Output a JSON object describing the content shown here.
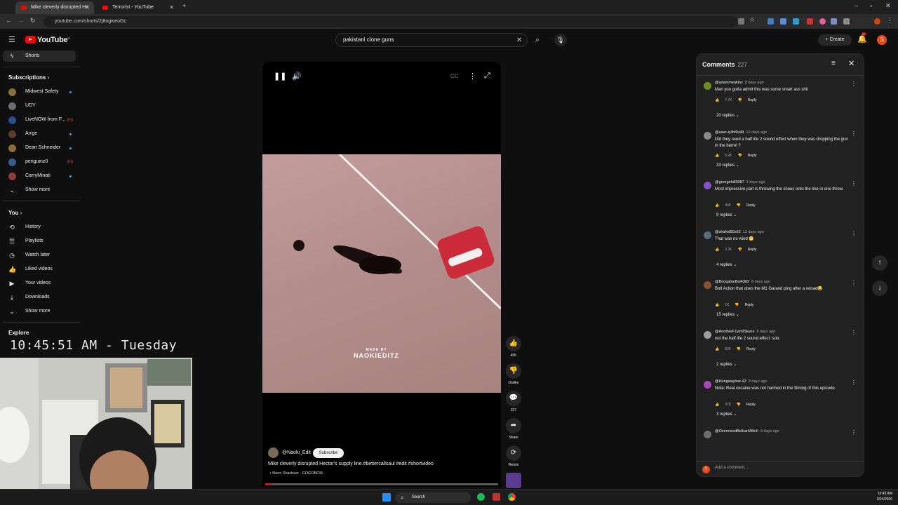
{
  "browser": {
    "tabs": [
      {
        "title": "Mike cleverly disrupted He"
      },
      {
        "title": "Terrorist - YouTube"
      }
    ],
    "url": "youtube.com/shorts/2j8ogiveoGc"
  },
  "header": {
    "logo": "YouTube",
    "logo_sup": "IN",
    "search_value": "pakistani clone guns",
    "create_label": "Create",
    "bell_badge": "9+",
    "avatar_letter": "S"
  },
  "sidebar": {
    "shorts_label": "Shorts",
    "subscriptions_label": "Subscriptions",
    "subscriptions": [
      {
        "label": "Midwest Safety",
        "color": "#8a6d3b",
        "marker": "dot"
      },
      {
        "label": "UDY",
        "color": "#6d6d6d",
        "marker": ""
      },
      {
        "label": "LiveNOW from F...",
        "color": "#2a4d8f",
        "marker": "live"
      },
      {
        "label": "Arrge",
        "color": "#5a3d2b",
        "marker": "dot"
      },
      {
        "label": "Dean Schneider",
        "color": "#8f6b3a",
        "marker": "dot"
      },
      {
        "label": "penguinz0",
        "color": "#3b5a8f",
        "marker": "live"
      },
      {
        "label": "CarryMinati",
        "color": "#8f3b3b",
        "marker": "dot"
      }
    ],
    "show_more": "Show more",
    "you_label": "You",
    "you_items": [
      {
        "label": "History",
        "icon": "history-icon",
        "glyph": "⟲"
      },
      {
        "label": "Playlists",
        "icon": "playlists-icon",
        "glyph": "☰"
      },
      {
        "label": "Watch later",
        "icon": "watch-later-icon",
        "glyph": "◷"
      },
      {
        "label": "Liked videos",
        "icon": "like-icon",
        "glyph": "👍"
      },
      {
        "label": "Your videos",
        "icon": "your-videos-icon",
        "glyph": "▶"
      },
      {
        "label": "Downloads",
        "icon": "download-icon",
        "glyph": "⤓"
      }
    ],
    "show_more_2": "Show more",
    "explore_label": "Explore"
  },
  "overlay": {
    "clock": "10:45:51 AM - Tuesday"
  },
  "video": {
    "watermark_top": "MADE BY",
    "watermark": "NAOKIEDITZ",
    "channel": "@Naoki_Edit",
    "subscribe_label": "Subscribe",
    "title": "Mike cleverly disrupted Hector's supply line.#bettercallsaul #edit #shortvideo",
    "music": "Neon Shadows · GOGOBCM",
    "progress": 0.03
  },
  "actions": {
    "like_count": "40K",
    "dislike_label": "Dislike",
    "comment_count": "227",
    "share_label": "Share",
    "remix_label": "Remix"
  },
  "comments": {
    "title": "Comments",
    "count": "227",
    "items": [
      {
        "user": "@adammeakinz",
        "age": "8 days ago",
        "text": "Man you gotta admit this was some smart ass shit",
        "likes": "7.7K",
        "replies": "20 replies",
        "color": "#6b8e23"
      },
      {
        "user": "@user-zj4hl9ui8t",
        "age": "10 days ago",
        "text": "Did they used a half life 2 sound effect when they was dropping the gun in the barrel ?",
        "likes": "6.2K",
        "replies": "33 replies",
        "color": "#8a8a8a"
      },
      {
        "user": "@georgehill3087",
        "age": "3 days ago",
        "text": "Most impressive part is throwing the shoes onto the line in one throw.",
        "likes": "409",
        "replies": "9 replies",
        "color": "#7e57c2"
      },
      {
        "user": "@shahid55s52",
        "age": "13 days ago",
        "text": "That was no wind 😁",
        "likes": "2.2K",
        "replies": "4 replies",
        "color": "#5c6b7a"
      },
      {
        "user": "@BoogalooBoi4382",
        "age": "8 days ago",
        "text": "Bolt Action that does the M1 Garand ping after a reload😂",
        "likes": "1K",
        "replies": "15 replies",
        "color": "#8d4f2f"
      },
      {
        "user": "@AnotherF1yin9Skyes",
        "age": "9 days ago",
        "text": "not the half life 2 sound effect :sob:",
        "likes": "839",
        "replies": "2 replies",
        "color": "#9e9e9e"
      },
      {
        "user": "@Hungwaylow-42",
        "age": "9 days ago",
        "text": "Note: Real cocaine was not harmed in the filming of this episode.",
        "likes": "379",
        "replies": "3 replies",
        "color": "#ab47bc"
      },
      {
        "user": "@OvermeedBelkanWitch",
        "age": "9 days ago",
        "text": "",
        "likes": "",
        "replies": "",
        "color": "#6d6d6d"
      }
    ],
    "reply_label": "Reply",
    "add_placeholder": "Add a comment..."
  },
  "taskbar": {
    "search_label": "Search",
    "time": "10:45 AM",
    "date": "3/24/2026"
  }
}
